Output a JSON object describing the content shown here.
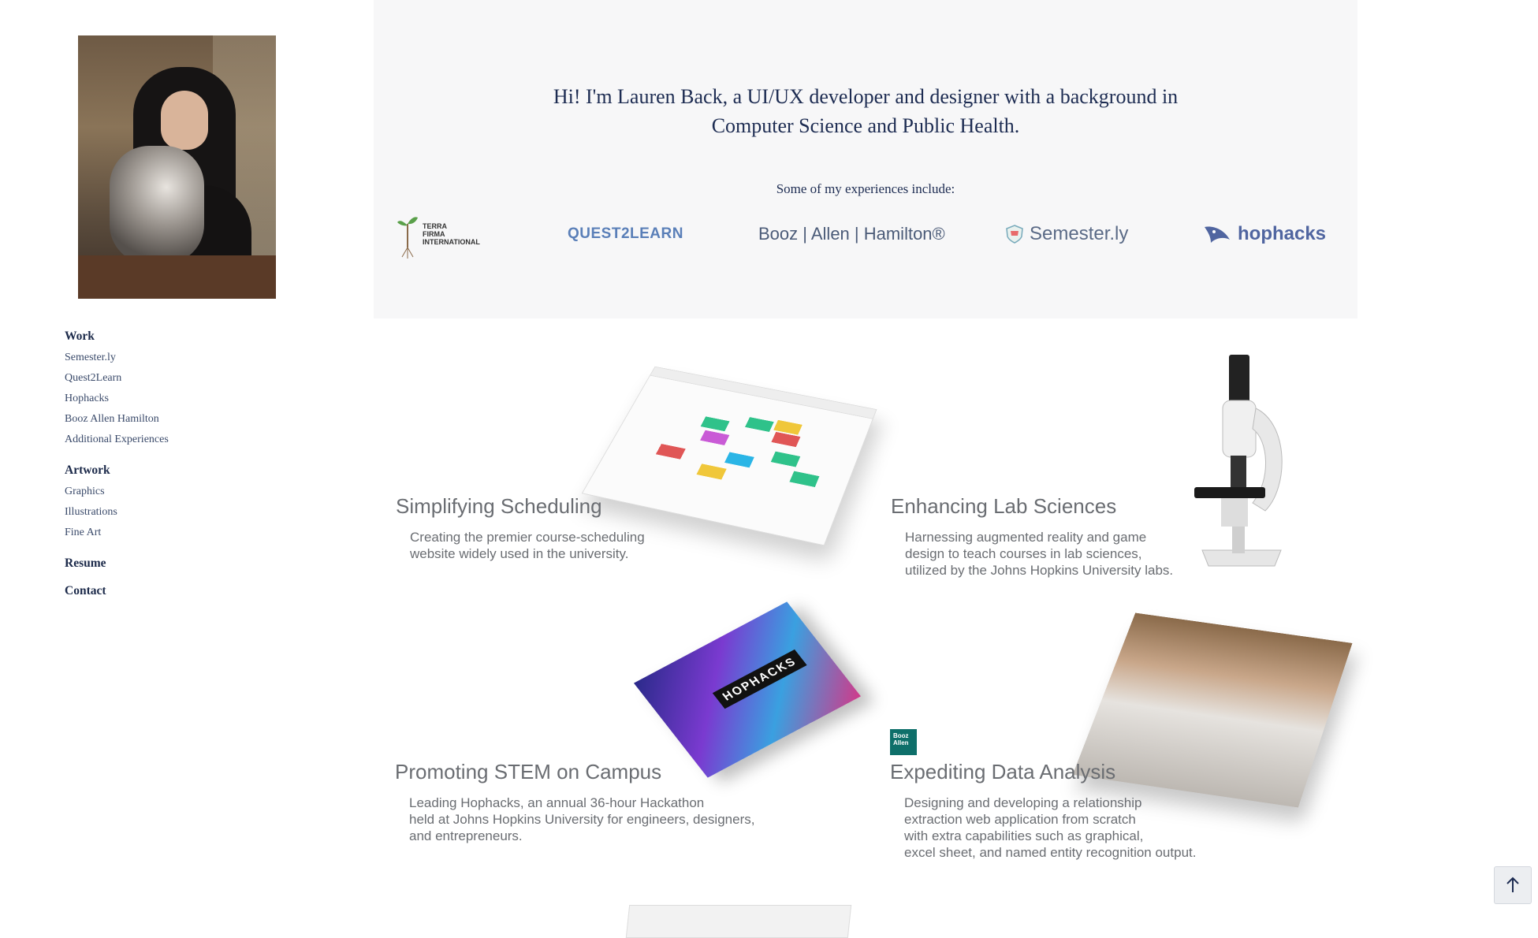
{
  "sidebar": {
    "nav": {
      "work": {
        "heading": "Work",
        "items": [
          "Semester.ly",
          "Quest2Learn",
          "Hophacks",
          "Booz Allen Hamilton",
          "Additional Experiences"
        ]
      },
      "artwork": {
        "heading": "Artwork",
        "items": [
          "Graphics",
          "Illustrations",
          "Fine Art"
        ]
      },
      "resume": "Resume",
      "contact": "Contact"
    }
  },
  "hero": {
    "title_line1": "Hi! I'm Lauren Back, a UI/UX developer and designer with a background in",
    "title_line2": "Computer Science and Public Health.",
    "subtitle": "Some of my experiences include:",
    "logos": {
      "terra": [
        "TERRA",
        "FIRMA",
        "INTERNATIONAL"
      ],
      "quest": "QUEST2LEARN",
      "booz": "Booz | Allen | Hamilton®",
      "semester": "Semester.ly",
      "hophacks": "hophacks"
    }
  },
  "cards": [
    {
      "title": "Simplifying Scheduling",
      "desc": [
        "Creating the premier course-scheduling",
        "website widely used in the university."
      ]
    },
    {
      "title": "Enhancing Lab Sciences",
      "desc": [
        "Harnessing augmented reality and game",
        "design to teach courses in lab sciences,",
        "utilized by the Johns Hopkins University labs."
      ]
    },
    {
      "title": "Promoting STEM on Campus",
      "desc": [
        "Leading Hophacks, an annual 36-hour Hackathon",
        "held at Johns Hopkins University for engineers, designers,",
        "and entrepreneurs."
      ],
      "image_text": "HOPHACKS"
    },
    {
      "title": "Expediting Data Analysis",
      "desc": [
        "Designing and developing a relationship",
        "extraction web application from scratch",
        "with extra capabilities such as graphical,",
        "excel sheet, and named entity recognition output."
      ],
      "badge": [
        "Booz",
        "Allen"
      ]
    }
  ],
  "colors": {
    "nav_heading": "#1c2a4a",
    "hero_bg": "#f7f7f8",
    "hero_text": "#1d2c52",
    "card_text": "#6a6d72"
  },
  "icons": {
    "back_to_top": "arrow-up-icon"
  }
}
